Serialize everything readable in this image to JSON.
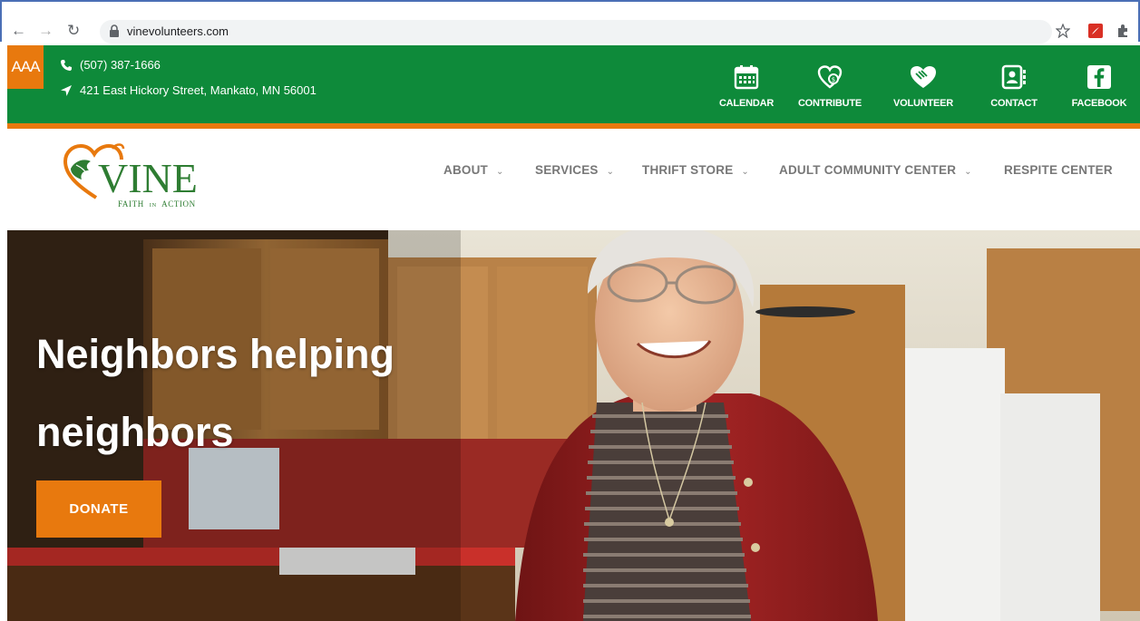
{
  "browser": {
    "url": "vinevolunteers.com"
  },
  "topbar": {
    "aaa_label": "AAA",
    "phone": "(507) 387-1666",
    "address": "421 East Hickory Street, Mankato, MN 56001",
    "quicklinks": [
      {
        "label": "CALENDAR",
        "icon": "calendar-icon"
      },
      {
        "label": "CONTRIBUTE",
        "icon": "contribute-heart-icon"
      },
      {
        "label": "VOLUNTEER",
        "icon": "volunteer-hands-heart-icon"
      },
      {
        "label": "CONTACT",
        "icon": "contact-card-icon"
      },
      {
        "label": "FACEBOOK",
        "icon": "facebook-icon"
      }
    ]
  },
  "header": {
    "logo_text": "VINE",
    "logo_tagline_faith": "FAITH",
    "logo_tagline_in": "IN",
    "logo_tagline_action": "ACTION",
    "nav": [
      {
        "label": "ABOUT",
        "has_dropdown": true
      },
      {
        "label": "SERVICES",
        "has_dropdown": true
      },
      {
        "label": "THRIFT STORE",
        "has_dropdown": true
      },
      {
        "label": "ADULT COMMUNITY CENTER",
        "has_dropdown": true
      },
      {
        "label": "RESPITE CENTER",
        "has_dropdown": false
      }
    ]
  },
  "hero": {
    "title_line1": "Neighbors helping",
    "title_line2": "neighbors",
    "donate_label": "DONATE"
  },
  "colors": {
    "green": "#0e8a3a",
    "orange": "#e8790e",
    "nav_gray": "#777777"
  }
}
